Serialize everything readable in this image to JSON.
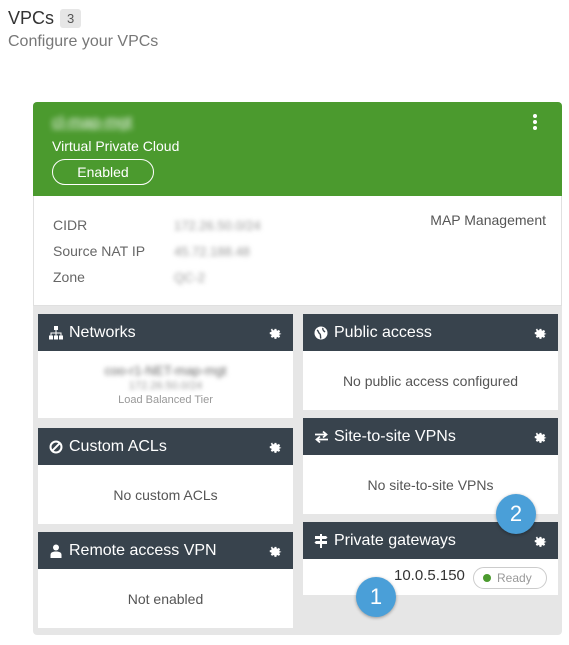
{
  "header": {
    "title": "VPCs",
    "count": "3",
    "subtitle": "Configure your VPCs"
  },
  "vpc": {
    "name": "cl-map-mgt",
    "type": "Virtual Private Cloud",
    "status": "Enabled",
    "colors": {
      "header": "#4b9a2e",
      "section": "#38434d",
      "marker": "#4a9fd8"
    },
    "info": {
      "cidr_label": "CIDR",
      "cidr_value": "172.26.50.0/24",
      "snat_label": "Source NAT IP",
      "snat_value": "45.72.188.48",
      "zone_label": "Zone",
      "zone_value": "QC-2",
      "project": "MAP Management"
    },
    "sections": {
      "networks": {
        "title": "Networks",
        "icon": "sitemap-icon",
        "network_name": "coo-r1-NET-map-mgt",
        "network_cidr": "172.26.50.0/24",
        "network_tier": "Load Balanced Tier"
      },
      "public_access": {
        "title": "Public access",
        "icon": "globe-icon",
        "empty_text": "No public access configured"
      },
      "custom_acls": {
        "title": "Custom ACLs",
        "icon": "ban-icon",
        "empty_text": "No custom ACLs"
      },
      "site_to_site": {
        "title": "Site-to-site VPNs",
        "icon": "exchange-icon",
        "empty_text": "No site-to-site VPNs"
      },
      "remote_vpn": {
        "title": "Remote access VPN",
        "icon": "user-icon",
        "empty_text": "Not enabled"
      },
      "private_gateways": {
        "title": "Private gateways",
        "icon": "signpost-icon",
        "gateway_ip": "10.0.5.150",
        "gateway_status": "Ready"
      }
    }
  },
  "markers": {
    "one": "1",
    "two": "2"
  }
}
